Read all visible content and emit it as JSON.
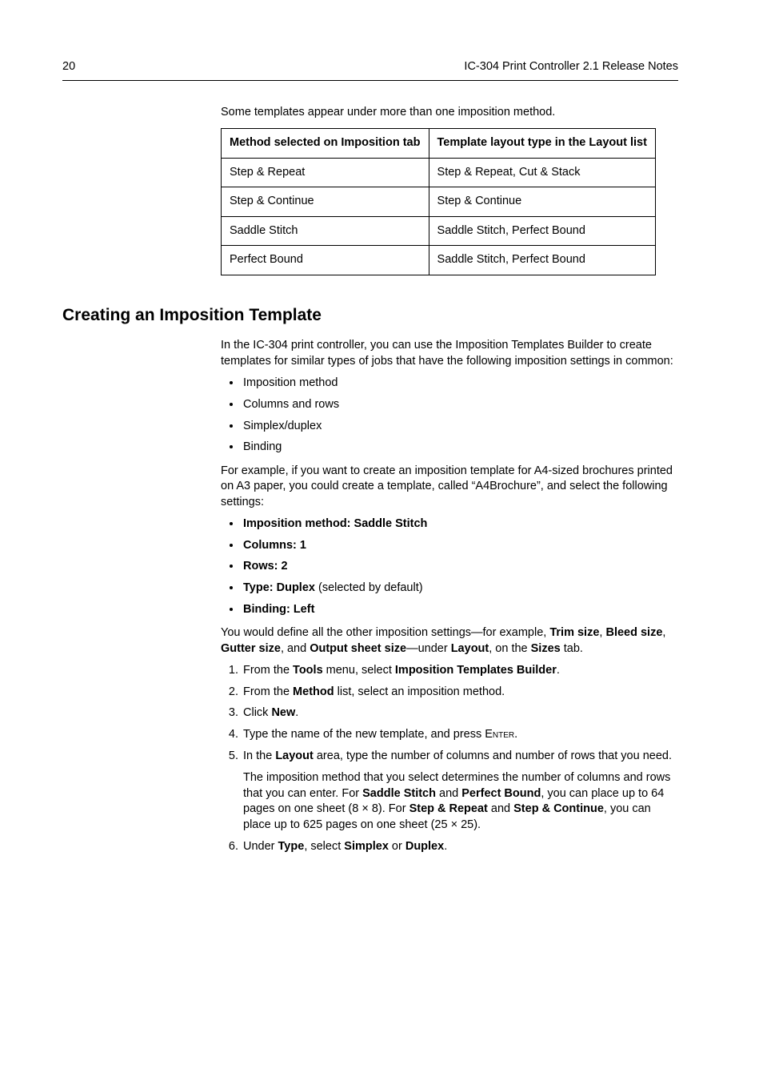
{
  "header": {
    "page_number": "20",
    "doc_title": "IC-304 Print Controller 2.1 Release Notes"
  },
  "intro_text": "Some templates appear under more than one imposition method.",
  "table": {
    "head": {
      "col1": "Method selected on Imposition tab",
      "col2": "Template layout type in the Layout list"
    },
    "rows": [
      {
        "c1": "Step & Repeat",
        "c2": "Step & Repeat, Cut & Stack"
      },
      {
        "c1": "Step & Continue",
        "c2": "Step & Continue"
      },
      {
        "c1": "Saddle Stitch",
        "c2": "Saddle Stitch, Perfect Bound"
      },
      {
        "c1": "Perfect Bound",
        "c2": "Saddle Stitch, Perfect Bound"
      }
    ]
  },
  "section_heading": "Creating an Imposition Template",
  "para1": "In the IC-304 print controller, you can use the Imposition Templates Builder to create templates for similar types of jobs that have the following imposition settings in common:",
  "bullets1": {
    "b0": "Imposition method",
    "b1": "Columns and rows",
    "b2": "Simplex/duplex",
    "b3": "Binding"
  },
  "para2": "For example, if you want to create an imposition template for A4-sized brochures printed on A3 paper, you could create a template, called “A4Brochure”, and select the following settings:",
  "bullets2": {
    "b0": "Imposition method: Saddle Stitch",
    "b1": "Columns: 1",
    "b2": "Rows: 2",
    "b3_prefix": "Type: Duplex",
    "b3_suffix": " (selected by default)",
    "b4": "Binding: Left"
  },
  "para3": {
    "t0": "You would define all the other imposition settings—for example, ",
    "b0": "Trim size",
    "t1": ", ",
    "b1": "Bleed size",
    "t2": ", ",
    "b2": "Gutter size",
    "t3": ", and ",
    "b3": "Output sheet size",
    "t4": "—under ",
    "b4": "Layout",
    "t5": ", on the ",
    "b5": "Sizes",
    "t6": " tab."
  },
  "steps": {
    "s1": {
      "t0": "From the ",
      "b0": "Tools",
      "t1": " menu, select ",
      "b1": "Imposition Templates Builder",
      "t2": "."
    },
    "s2": {
      "t0": "From the ",
      "b0": "Method",
      "t1": " list, select an imposition method."
    },
    "s3": {
      "t0": "Click ",
      "b0": "New",
      "t1": "."
    },
    "s4": {
      "t0": "Type the name of the new template, and press ",
      "sc": "Enter",
      "t1": "."
    },
    "s5": {
      "t0": "In the ",
      "b0": "Layout",
      "t1": " area, type the number of columns and number of rows that you need.",
      "p2_t0": "The imposition method that you select determines the number of columns and rows that you can enter. For ",
      "p2_b0": "Saddle Stitch",
      "p2_t1": " and ",
      "p2_b1": "Perfect Bound",
      "p2_t2": ", you can place up to 64 pages on one sheet (8 × 8). For ",
      "p2_b2": "Step & Repeat",
      "p2_t3": " and ",
      "p2_b3": "Step & Continue",
      "p2_t4": ", you can place up to 625 pages on one sheet (25 × 25)."
    },
    "s6": {
      "t0": "Under ",
      "b0": "Type",
      "t1": ", select ",
      "b1": "Simplex",
      "t2": " or ",
      "b2": "Duplex",
      "t3": "."
    }
  }
}
